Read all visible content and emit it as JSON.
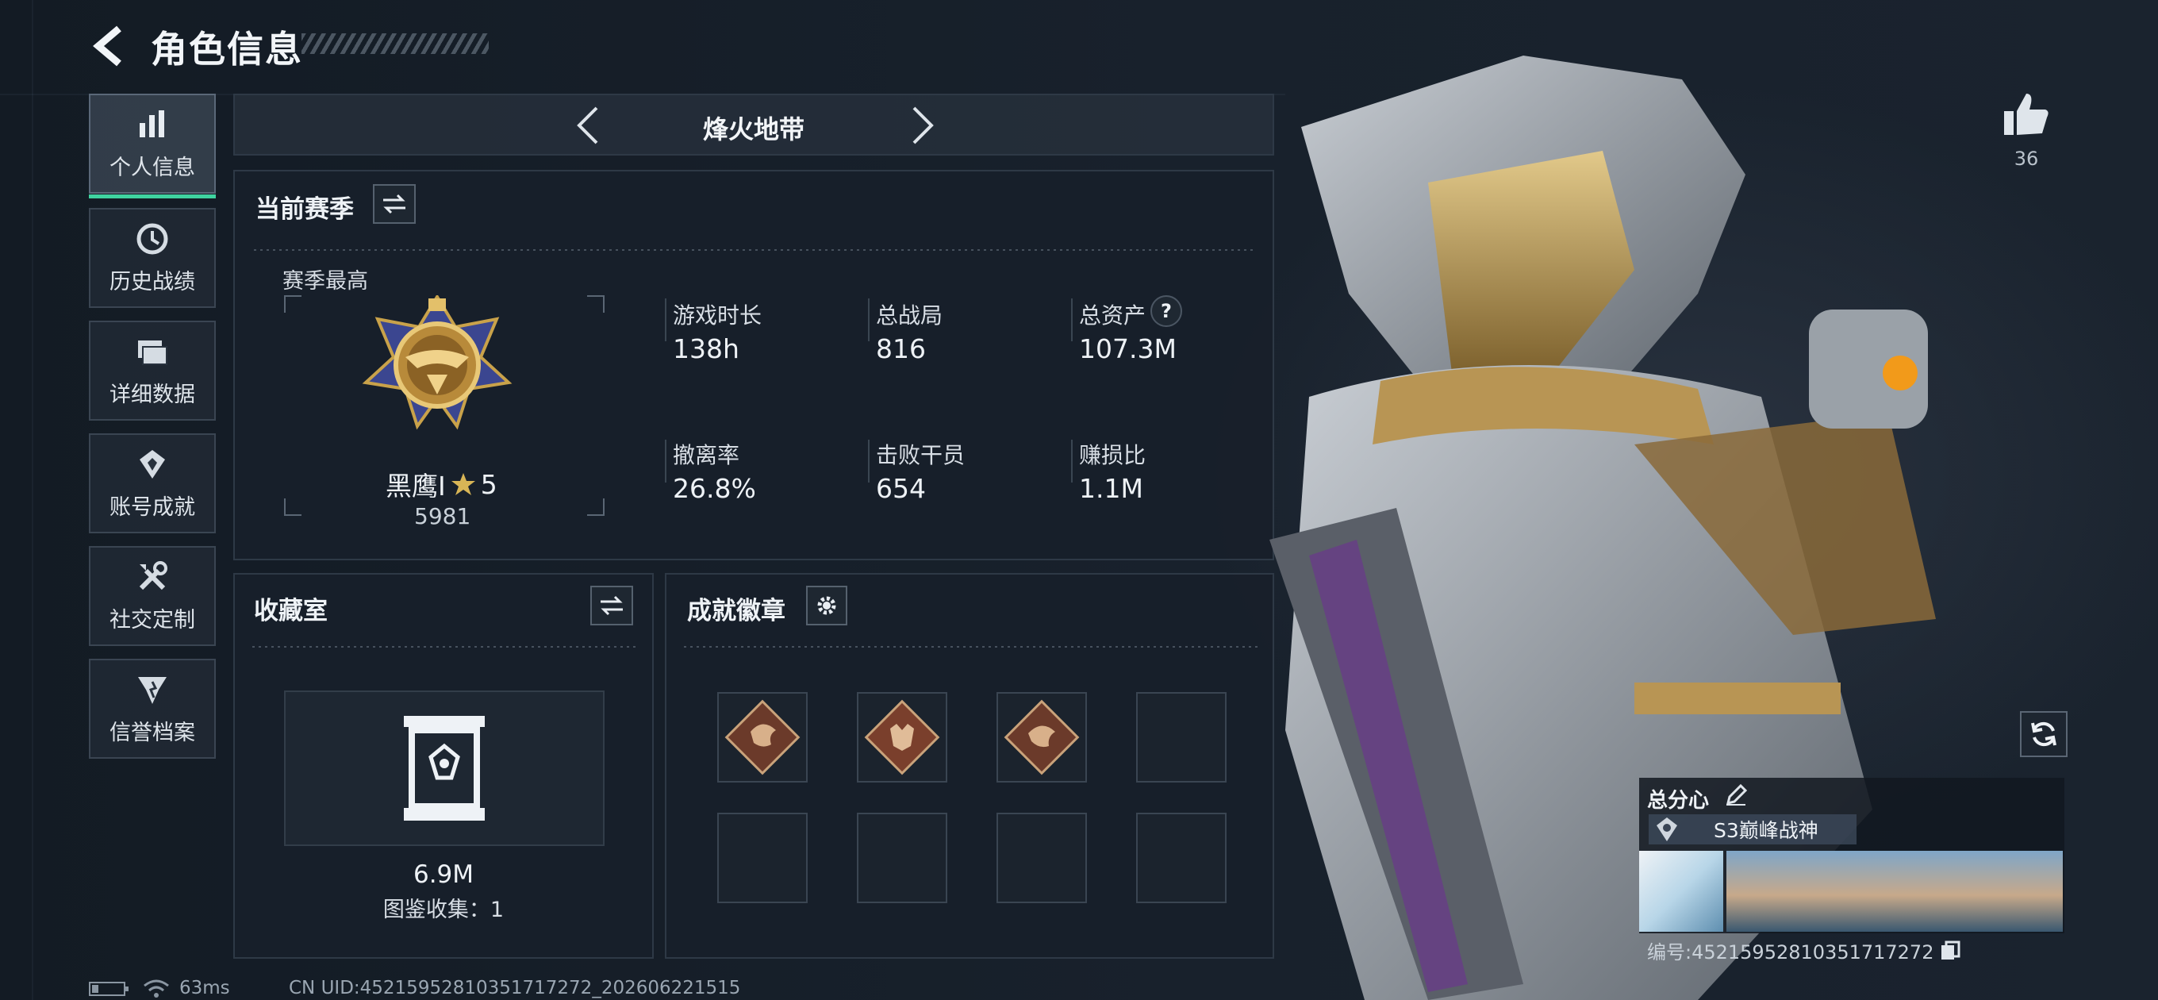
{
  "header": {
    "title": "角色信息"
  },
  "sidebar": {
    "items": [
      {
        "label": "个人信息",
        "icon": "bar-chart-icon"
      },
      {
        "label": "历史战绩",
        "icon": "history-icon"
      },
      {
        "label": "详细数据",
        "icon": "folder-icon"
      },
      {
        "label": "账号成就",
        "icon": "achievement-icon"
      },
      {
        "label": "社交定制",
        "icon": "tools-icon"
      },
      {
        "label": "信誉档案",
        "icon": "credit-icon"
      }
    ]
  },
  "mode_selector": {
    "label": "烽火地带"
  },
  "season": {
    "title": "当前赛季",
    "highest_label": "赛季最高",
    "rank_name": "黑鹰I",
    "rank_stars": "5",
    "rank_score": "5981",
    "stats": [
      {
        "label": "游戏时长",
        "value": "138h"
      },
      {
        "label": "总战局",
        "value": "816"
      },
      {
        "label": "总资产",
        "value": "107.3M"
      },
      {
        "label": "撤离率",
        "value": "26.8%"
      },
      {
        "label": "击败干员",
        "value": "654"
      },
      {
        "label": "赚损比",
        "value": "1.1M"
      }
    ],
    "help_glyph": "?"
  },
  "collection": {
    "title": "收藏室",
    "value": "6.9M",
    "catalog_label": "图鉴收集：1"
  },
  "achievements": {
    "title": "成就徽章"
  },
  "likes": {
    "count": "36"
  },
  "profile_card": {
    "title": "总分心",
    "tag": "S3巅峰战神",
    "id_line": "编号:4521595281035171727​2"
  },
  "status_bar": {
    "latency": "63ms",
    "uid": "CN UID:452159528103517172​72_202606221515"
  },
  "colors": {
    "accent": "#3fd3a0",
    "gold": "#c9a24a",
    "panel": "#18202a"
  }
}
